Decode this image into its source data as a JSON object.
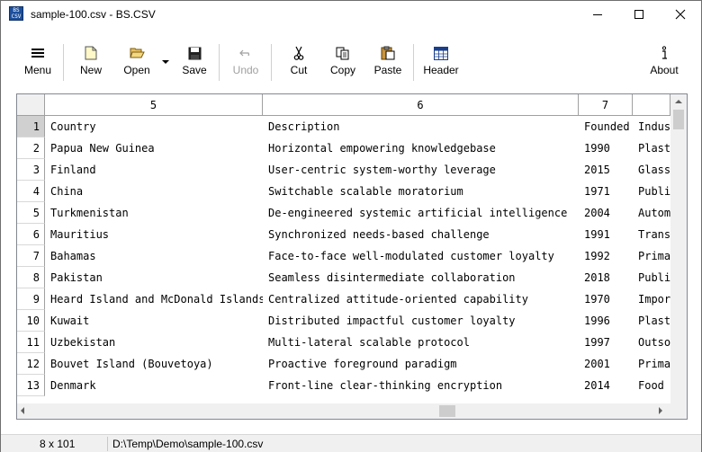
{
  "window": {
    "title": "sample-100.csv - BS.CSV",
    "app_icon_text": "BS\nCSV"
  },
  "toolbar": {
    "menu": "Menu",
    "new": "New",
    "open": "Open",
    "save": "Save",
    "undo": "Undo",
    "cut": "Cut",
    "copy": "Copy",
    "paste": "Paste",
    "header": "Header",
    "about": "About"
  },
  "grid": {
    "columns": [
      "5",
      "6",
      "7",
      ""
    ],
    "rows": [
      {
        "num": "1",
        "cells": [
          "Country",
          "Description",
          "Founded",
          "Indus"
        ]
      },
      {
        "num": "2",
        "cells": [
          "Papua New Guinea",
          "Horizontal empowering knowledgebase",
          "1990",
          "Plast"
        ]
      },
      {
        "num": "3",
        "cells": [
          "Finland",
          "User-centric system-worthy leverage",
          "2015",
          "Glass"
        ]
      },
      {
        "num": "4",
        "cells": [
          "China",
          "Switchable scalable moratorium",
          "1971",
          "Publi"
        ]
      },
      {
        "num": "5",
        "cells": [
          "Turkmenistan",
          "De-engineered systemic artificial intelligence",
          "2004",
          "Autom"
        ]
      },
      {
        "num": "6",
        "cells": [
          "Mauritius",
          "Synchronized needs-based challenge",
          "1991",
          "Trans"
        ]
      },
      {
        "num": "7",
        "cells": [
          "Bahamas",
          "Face-to-face well-modulated customer loyalty",
          "1992",
          "Prima"
        ]
      },
      {
        "num": "8",
        "cells": [
          "Pakistan",
          "Seamless disintermediate collaboration",
          "2018",
          "Publi"
        ]
      },
      {
        "num": "9",
        "cells": [
          "Heard Island and McDonald Islands",
          "Centralized attitude-oriented capability",
          "1970",
          "Impor"
        ]
      },
      {
        "num": "10",
        "cells": [
          "Kuwait",
          "Distributed impactful customer loyalty",
          "1996",
          "Plast"
        ]
      },
      {
        "num": "11",
        "cells": [
          "Uzbekistan",
          "Multi-lateral scalable protocol",
          "1997",
          "Outso"
        ]
      },
      {
        "num": "12",
        "cells": [
          "Bouvet Island (Bouvetoya)",
          "Proactive foreground paradigm",
          "2001",
          "Prima"
        ]
      },
      {
        "num": "13",
        "cells": [
          "Denmark",
          "Front-line clear-thinking encryption",
          "2014",
          "Food "
        ]
      }
    ]
  },
  "status": {
    "dimensions": "8 x 101",
    "path": "D:\\Temp\\Demo\\sample-100.csv"
  }
}
